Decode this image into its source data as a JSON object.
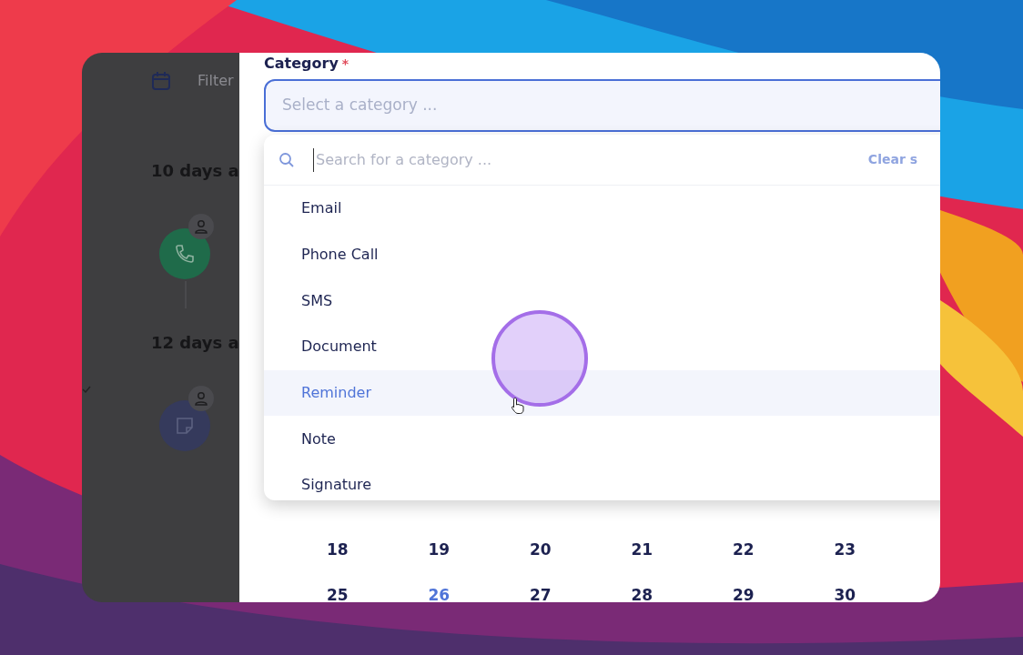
{
  "timeline": {
    "filter_placeholder": "Filter",
    "groups": [
      {
        "heading": "10 days a",
        "entries": [
          {
            "kind": "call"
          }
        ]
      },
      {
        "heading": "12 days a",
        "entries": [
          {
            "kind": "note"
          }
        ]
      }
    ]
  },
  "form": {
    "category_label": "Category",
    "required_mark": "*",
    "select": {
      "placeholder": "Select a category ...",
      "focused": true
    },
    "dropdown": {
      "search_placeholder": "Search for a category ...",
      "clear_label": "Clear s",
      "options": [
        {
          "label": "Email",
          "hovered": false
        },
        {
          "label": "Phone Call",
          "hovered": false
        },
        {
          "label": "SMS",
          "hovered": false
        },
        {
          "label": "Document",
          "hovered": false
        },
        {
          "label": "Reminder",
          "hovered": true
        },
        {
          "label": "Note",
          "hovered": false
        },
        {
          "label": "Signature",
          "hovered": false
        }
      ]
    }
  },
  "calendar": {
    "weeks": [
      [
        {
          "day": "18",
          "today": false
        },
        {
          "day": "19",
          "today": false
        },
        {
          "day": "20",
          "today": false
        },
        {
          "day": "21",
          "today": false
        },
        {
          "day": "22",
          "today": false
        },
        {
          "day": "23",
          "today": false
        }
      ],
      [
        {
          "day": "25",
          "today": false
        },
        {
          "day": "26",
          "today": true
        },
        {
          "day": "27",
          "today": false
        },
        {
          "day": "28",
          "today": false
        },
        {
          "day": "29",
          "today": false
        },
        {
          "day": "30",
          "today": false
        }
      ]
    ]
  }
}
